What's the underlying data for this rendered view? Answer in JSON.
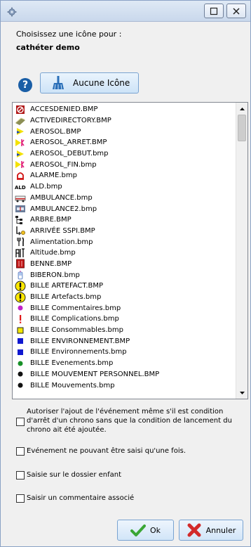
{
  "window": {
    "minimize_label": "Minimize",
    "close_label": "Close"
  },
  "header": {
    "prompt": "Choisissez une icône pour :",
    "target": "cathéter demo"
  },
  "toolbar": {
    "no_icon_label": "Aucune Icône"
  },
  "icon_list": [
    {
      "name": "ACCESDENIED.BMP",
      "icon": "access-denied-icon"
    },
    {
      "name": "ACTIVEDIRECTORY.BMP",
      "icon": "active-directory-icon"
    },
    {
      "name": "AEROSOL.BMP",
      "icon": "aerosol-icon"
    },
    {
      "name": "AEROSOL_ARRET.BMP",
      "icon": "aerosol-stop-icon"
    },
    {
      "name": "AEROSOL_DEBUT.bmp",
      "icon": "aerosol-start-icon"
    },
    {
      "name": "AEROSOL_FIN.bmp",
      "icon": "aerosol-end-icon"
    },
    {
      "name": "ALARME.bmp",
      "icon": "alarm-bell-icon"
    },
    {
      "name": "ALD.bmp",
      "icon": "ald-text-icon"
    },
    {
      "name": "AMBULANCE.bmp",
      "icon": "ambulance-icon"
    },
    {
      "name": "AMBULANCE2.bmp",
      "icon": "ambulance2-icon"
    },
    {
      "name": "ARBRE.BMP",
      "icon": "tree-icon"
    },
    {
      "name": "ARRIVÉE SSPI.BMP",
      "icon": "arrival-icon"
    },
    {
      "name": "Alimentation.bmp",
      "icon": "fork-knife-icon"
    },
    {
      "name": "Altitude.bmp",
      "icon": "altitude-icon"
    },
    {
      "name": "BENNE.BMP",
      "icon": "dumpster-icon"
    },
    {
      "name": "BIBERON.bmp",
      "icon": "baby-bottle-icon"
    },
    {
      "name": "BILLE ARTEFACT.BMP",
      "icon": "warning-ball-icon"
    },
    {
      "name": "BILLE Artefacts.bmp",
      "icon": "warning-ball-icon"
    },
    {
      "name": "BILLE Commentaires.bmp",
      "icon": "purple-dot-icon"
    },
    {
      "name": "BILLE Complications.bmp",
      "icon": "red-exclamation-icon"
    },
    {
      "name": "BILLE Consommables.bmp",
      "icon": "yellow-square-icon"
    },
    {
      "name": "BILLE ENVIRONNEMENT.BMP",
      "icon": "blue-square-icon"
    },
    {
      "name": "BILLE Environnements.bmp",
      "icon": "blue-square-icon"
    },
    {
      "name": "BILLE Evenements.bmp",
      "icon": "green-dot-icon"
    },
    {
      "name": "BILLE MOUVEMENT PERSONNEL.BMP",
      "icon": "black-dot-icon"
    },
    {
      "name": "BILLE Mouvements.bmp",
      "icon": "black-dot-icon"
    }
  ],
  "options": [
    {
      "label": "Autoriser l'ajout de l'événement même s'il est condition d'arrêt d'un chrono sans que la condition de lancement du chrono ait été ajoutée.",
      "checked": false
    },
    {
      "label": "Evénement ne pouvant être saisi qu'une fois.",
      "checked": false
    },
    {
      "label": "Saisie sur le dossier enfant",
      "checked": false
    },
    {
      "label": "Saisir un commentaire associé",
      "checked": false
    }
  ],
  "buttons": {
    "ok_label": "Ok",
    "cancel_label": "Annuler"
  },
  "colors": {
    "accent": "#1a5ea6",
    "ok_green": "#3aa635",
    "cancel_red": "#d22a2a"
  }
}
